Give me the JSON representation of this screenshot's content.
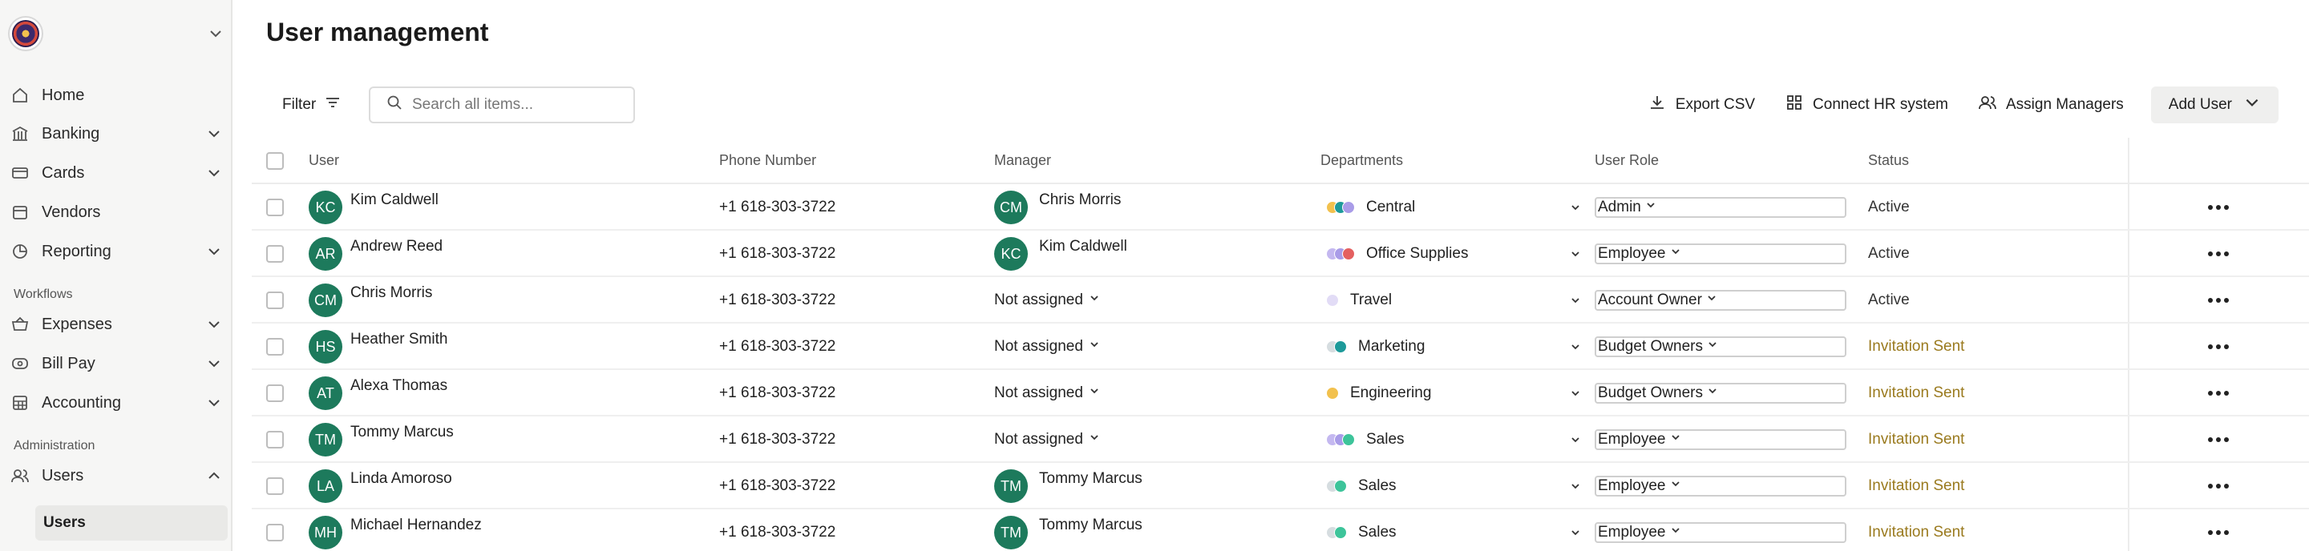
{
  "sidebar": {
    "items": [
      {
        "label": "Home",
        "icon": "home-icon"
      },
      {
        "label": "Banking",
        "icon": "bank-icon"
      },
      {
        "label": "Cards",
        "icon": "card-icon"
      },
      {
        "label": "Vendors",
        "icon": "vendor-icon"
      },
      {
        "label": "Reporting",
        "icon": "chart-icon"
      }
    ],
    "workflows_label": "Workflows",
    "workflow_items": [
      {
        "label": "Expenses",
        "icon": "expense-icon"
      },
      {
        "label": "Bill Pay",
        "icon": "bill-icon"
      },
      {
        "label": "Accounting",
        "icon": "accounting-icon"
      }
    ],
    "administration_label": "Administration",
    "admin_item": {
      "label": "Users",
      "icon": "users-icon"
    },
    "sub_item": "Users"
  },
  "page": {
    "title": "User management"
  },
  "toolbar": {
    "filter_label": "Filter",
    "search_placeholder": "Search all items...",
    "export_label": "Export CSV",
    "connect_label": "Connect HR system",
    "assign_label": "Assign Managers",
    "add_user_label": "Add User"
  },
  "table": {
    "headers": {
      "user": "User",
      "phone": "Phone Number",
      "manager": "Manager",
      "departments": "Departments",
      "role": "User Role",
      "status": "Status"
    },
    "rows": [
      {
        "initials": "KC",
        "name": "Kim Caldwell",
        "phone": "+1 618-303-3722",
        "manager_initials": "CM",
        "manager": "Chris Morris",
        "department": "Central",
        "dept_colors": [
          "#f2c14e",
          "#1d9a9a",
          "#a99ce8"
        ],
        "role": "Admin",
        "status": "Active"
      },
      {
        "initials": "AR",
        "name": "Andrew Reed",
        "phone": "+1 618-303-3722",
        "manager_initials": "KC",
        "manager": "Kim Caldwell",
        "department": "Office Supplies",
        "dept_colors": [
          "#c4b8f0",
          "#a99ce8",
          "#e46060"
        ],
        "role": "Employee",
        "status": "Active"
      },
      {
        "initials": "CM",
        "name": "Chris Morris",
        "phone": "+1 618-303-3722",
        "manager_initials": "",
        "manager": "Not assigned",
        "department": "Travel",
        "dept_colors": [
          "#e2dcf6"
        ],
        "role": "Account Owner",
        "status": "Active"
      },
      {
        "initials": "HS",
        "name": "Heather Smith",
        "phone": "+1 618-303-3722",
        "manager_initials": "",
        "manager": "Not assigned",
        "department": "Marketing",
        "dept_colors": [
          "#d6dde0",
          "#1d9a9a"
        ],
        "role": "Budget Owners",
        "status": "Invitation Sent"
      },
      {
        "initials": "AT",
        "name": "Alexa Thomas",
        "phone": "+1 618-303-3722",
        "manager_initials": "",
        "manager": "Not assigned",
        "department": "Engineering",
        "dept_colors": [
          "#f2c14e"
        ],
        "role": "Budget Owners",
        "status": "Invitation Sent"
      },
      {
        "initials": "TM",
        "name": "Tommy Marcus",
        "phone": "+1 618-303-3722",
        "manager_initials": "",
        "manager": "Not assigned",
        "department": "Sales",
        "dept_colors": [
          "#c4b8f0",
          "#a99ce8",
          "#3dc49a"
        ],
        "role": "Employee",
        "status": "Invitation Sent"
      },
      {
        "initials": "LA",
        "name": "Linda Amoroso",
        "phone": "+1 618-303-3722",
        "manager_initials": "TM",
        "manager": "Tommy Marcus",
        "department": "Sales",
        "dept_colors": [
          "#d6dde0",
          "#3dc49a"
        ],
        "role": "Employee",
        "status": "Invitation Sent"
      },
      {
        "initials": "MH",
        "name": "Michael Hernandez",
        "phone": "+1 618-303-3722",
        "manager_initials": "TM",
        "manager": "Tommy Marcus",
        "department": "Sales",
        "dept_colors": [
          "#d6dde0",
          "#3dc49a"
        ],
        "role": "Employee",
        "status": "Invitation Sent"
      }
    ]
  },
  "colors": {
    "avatar": "#1d7a5c",
    "invite_status": "#9a7a1e",
    "sidebar_bg": "#f6f6f5"
  }
}
